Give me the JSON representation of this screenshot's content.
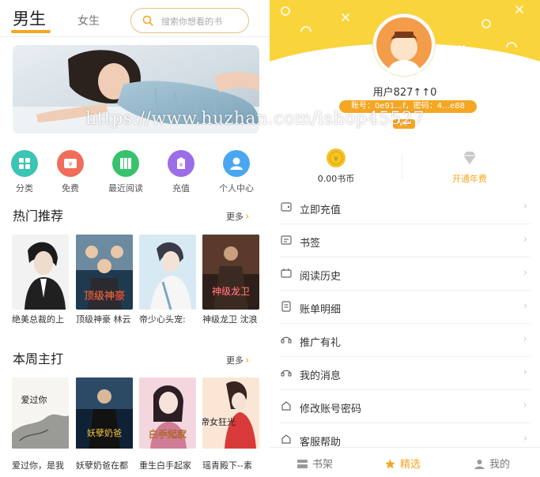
{
  "store": {
    "tabs": {
      "male": "男生",
      "female": "女生"
    },
    "search": {
      "placeholder": "搜索你想看的书"
    },
    "quick_links": [
      {
        "label": "分类",
        "icon": "category-icon",
        "color": "#3cc4b4"
      },
      {
        "label": "免费",
        "icon": "free-icon",
        "color": "#f06d5b"
      },
      {
        "label": "最近阅读",
        "icon": "recent-reading-icon",
        "color": "#38c26e"
      },
      {
        "label": "充值",
        "icon": "recharge-icon",
        "color": "#9b6ee8"
      },
      {
        "label": "个人中心",
        "icon": "user-center-icon",
        "color": "#4aa6f0"
      }
    ],
    "hot": {
      "title": "热门推荐",
      "more": "更多",
      "books": [
        {
          "title": "绝美总裁的上"
        },
        {
          "title": "顶级神豪 林云"
        },
        {
          "title": "帝少心头宠:"
        },
        {
          "title": "神级龙卫 沈浪"
        }
      ]
    },
    "weekly": {
      "title": "本周主打",
      "more": "更多",
      "books": [
        {
          "title": "爱过你，是我"
        },
        {
          "title": "妖孽奶爸在都"
        },
        {
          "title": "重生白手起家"
        },
        {
          "title": "瑶青殿下--素"
        }
      ]
    },
    "cover_text": {
      "hot_2": "顶级神豪",
      "hot_4": "神级龙卫",
      "weekly_1": "爱过你",
      "weekly_2": "妖孽奶爸",
      "weekly_3": "白手起家",
      "weekly_4": "帝女狂光"
    }
  },
  "profile": {
    "username": "用户827↑↑0",
    "account_line": "账号：0e91…f，密码：4…e88",
    "vip_badge": "VIP",
    "coins": {
      "value": "0.00书币"
    },
    "annual_fee": {
      "label": "开通年费"
    },
    "menu": [
      {
        "label": "立即充值",
        "icon": "wallet-icon"
      },
      {
        "label": "书签",
        "icon": "bookmark-icon"
      },
      {
        "label": "阅读历史",
        "icon": "history-icon"
      },
      {
        "label": "账单明细",
        "icon": "bill-icon"
      },
      {
        "label": "推广有礼",
        "icon": "promotion-icon"
      },
      {
        "label": "我的消息",
        "icon": "message-icon"
      },
      {
        "label": "修改账号密码",
        "icon": "password-icon"
      },
      {
        "label": "客服帮助",
        "icon": "help-icon"
      }
    ],
    "tabbar": [
      {
        "label": "书架",
        "icon": "bookshelf-icon",
        "active": false
      },
      {
        "label": "精选",
        "icon": "star-icon",
        "active": true
      },
      {
        "label": "我的",
        "icon": "user-icon",
        "active": false
      }
    ]
  },
  "watermark": "https://www.huzhan.com/ishop45527",
  "colors": {
    "accent": "#f5a623",
    "hero_yellow": "#f9d43a"
  }
}
